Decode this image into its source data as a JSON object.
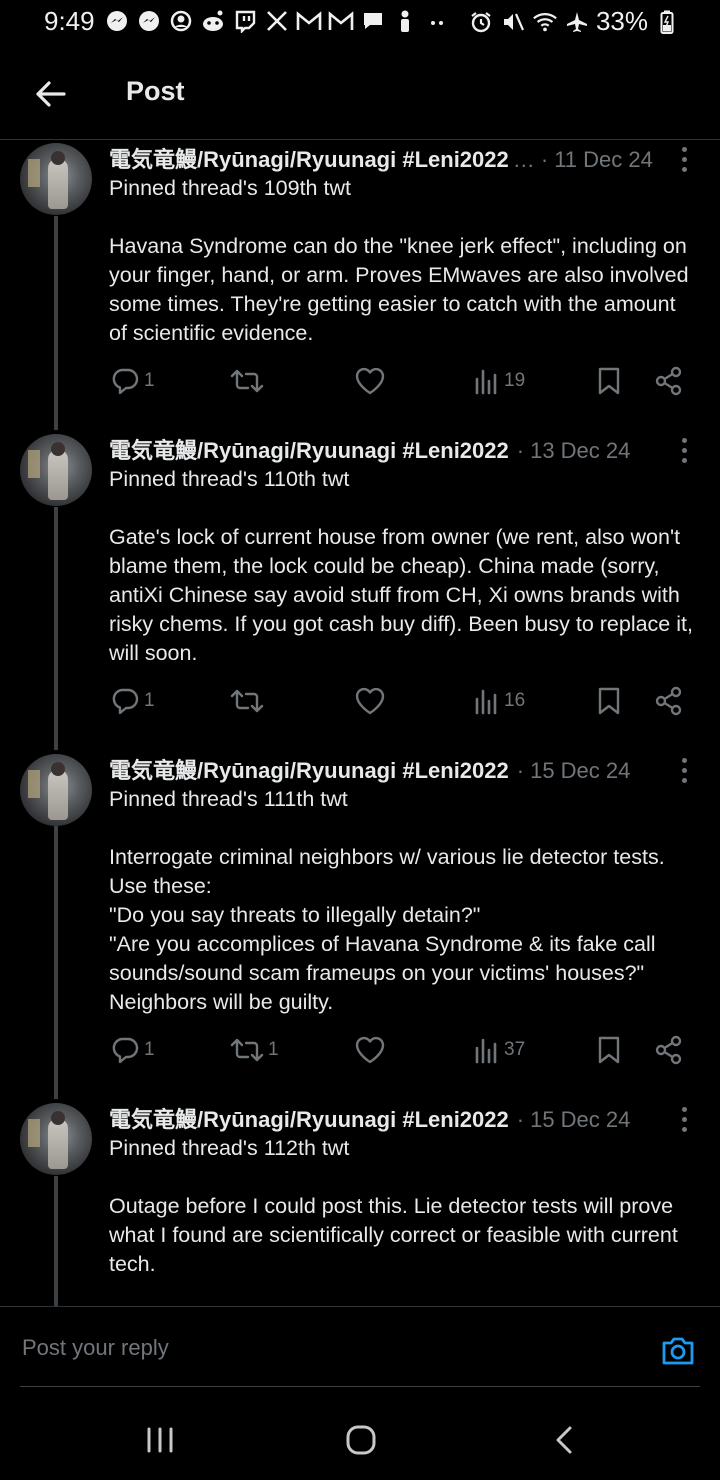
{
  "status_bar": {
    "time": "9:49",
    "battery": "33%",
    "left_icons": [
      "messenger-icon",
      "messenger-icon",
      "face-icon",
      "reddit-icon",
      "twitch-icon",
      "x-icon",
      "gmail-icon",
      "gmail-icon",
      "chat-icon",
      "person-icon",
      "more-dots-icon"
    ],
    "right_icons": [
      "alarm-icon",
      "mute-icon",
      "wifi-icon",
      "airplane-icon",
      "battery-icon"
    ]
  },
  "header": {
    "title": "Post"
  },
  "posts": [
    {
      "author": "電気竜鰻/Ryūnagi/Ryuunagi #Leni2022",
      "author_truncated": true,
      "date": "11 Dec 24",
      "text": "Pinned thread's 109th twt\n\nHavana Syndrome can do the \"knee jerk effect\", including on your finger, hand, or arm. Proves EMwaves are also involved some times. They're getting easier to catch with the amount of scientific evidence.",
      "replies": "1",
      "reposts": "",
      "likes": "",
      "views": "19"
    },
    {
      "author": "電気竜鰻/Ryūnagi/Ryuunagi #Leni2022",
      "author_truncated": false,
      "date": "13 Dec 24",
      "text": "Pinned thread's 110th twt\n\nGate's lock of current house from owner (we rent, also won't blame them, the lock could be cheap). China made (sorry, antiXi Chinese say avoid stuff from CH, Xi owns brands with risky chems. If you got cash buy diff). Been busy to replace it, will soon.",
      "replies": "1",
      "reposts": "",
      "likes": "",
      "views": "16"
    },
    {
      "author": "電気竜鰻/Ryūnagi/Ryuunagi #Leni2022",
      "author_truncated": false,
      "date": "15 Dec 24",
      "text": "Pinned thread's 111th twt\n\nInterrogate criminal neighbors w/ various lie detector tests. Use these:\n\"Do you say threats to illegally detain?\"\n\"Are you accomplices of Havana Syndrome & its fake call sounds/sound scam frameups on your victims' houses?\"\nNeighbors will be guilty.",
      "replies": "1",
      "reposts": "1",
      "likes": "",
      "views": "37"
    },
    {
      "author": "電気竜鰻/Ryūnagi/Ryuunagi #Leni2022",
      "author_truncated": false,
      "date": "15 Dec 24",
      "text": "Pinned thread's 112th twt\n\nOutage before I could post this. Lie detector tests will prove what I found are scientifically correct or feasible with current tech."
    }
  ],
  "reply_bar": {
    "placeholder": "Post your reply"
  },
  "colors": {
    "background": "#000000",
    "text_primary": "#e7e9ea",
    "text_secondary": "#71767b",
    "accent": "#1d9bf0",
    "divider": "#2f3336"
  }
}
